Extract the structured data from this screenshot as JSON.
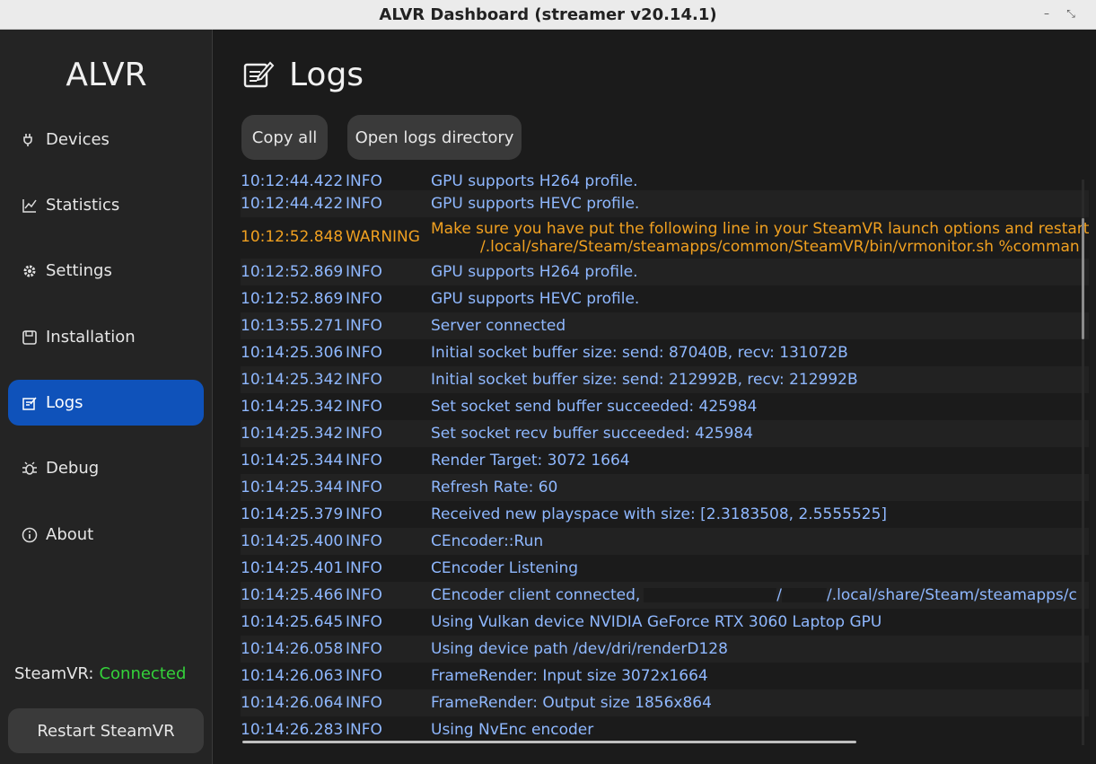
{
  "window": {
    "title": "ALVR Dashboard (streamer v20.14.1)"
  },
  "sidebar": {
    "brand": "ALVR",
    "items": [
      {
        "label": "Devices",
        "icon": "plug-icon"
      },
      {
        "label": "Statistics",
        "icon": "chart-icon"
      },
      {
        "label": "Settings",
        "icon": "gear-icon"
      },
      {
        "label": "Installation",
        "icon": "disk-icon"
      },
      {
        "label": "Logs",
        "icon": "notepad-icon",
        "active": true
      },
      {
        "label": "Debug",
        "icon": "bug-icon"
      },
      {
        "label": "About",
        "icon": "info-icon"
      }
    ],
    "steamvr_label": "SteamVR:",
    "steamvr_state": "Connected",
    "restart_label": "Restart SteamVR"
  },
  "main": {
    "title": "Logs",
    "copy_all_label": "Copy all",
    "open_dir_label": "Open logs directory"
  },
  "logs": [
    {
      "time": "10:12:44.422",
      "level": "INFO",
      "msg": "GPU supports H264 profile."
    },
    {
      "time": "10:12:44.422",
      "level": "INFO",
      "msg": "GPU supports HEVC profile."
    },
    {
      "time": "10:12:52.848",
      "level": "WARNING",
      "msg": "Make sure you have put the following line in your SteamVR launch options and restart it:",
      "msg2": "/.local/share/Steam/steamapps/common/SteamVR/bin/vrmonitor.sh %comman"
    },
    {
      "time": "10:12:52.869",
      "level": "INFO",
      "msg": "GPU supports H264 profile."
    },
    {
      "time": "10:12:52.869",
      "level": "INFO",
      "msg": "GPU supports HEVC profile."
    },
    {
      "time": "10:13:55.271",
      "level": "INFO",
      "msg": "Server connected"
    },
    {
      "time": "10:14:25.306",
      "level": "INFO",
      "msg": "Initial socket buffer size: send: 87040B, recv: 131072B"
    },
    {
      "time": "10:14:25.342",
      "level": "INFO",
      "msg": "Initial socket buffer size: send: 212992B, recv: 212992B"
    },
    {
      "time": "10:14:25.342",
      "level": "INFO",
      "msg": "Set socket send buffer succeeded: 425984"
    },
    {
      "time": "10:14:25.342",
      "level": "INFO",
      "msg": "Set socket recv buffer succeeded: 425984"
    },
    {
      "time": "10:14:25.344",
      "level": "INFO",
      "msg": "Render Target: 3072 1664"
    },
    {
      "time": "10:14:25.344",
      "level": "INFO",
      "msg": "Refresh Rate: 60"
    },
    {
      "time": "10:14:25.379",
      "level": "INFO",
      "msg": "Received new playspace with size: [2.3183508, 2.5555525]"
    },
    {
      "time": "10:14:25.400",
      "level": "INFO",
      "msg": "CEncoder::Run"
    },
    {
      "time": "10:14:25.401",
      "level": "INFO",
      "msg": "CEncoder Listening"
    },
    {
      "time": "10:14:25.466",
      "level": "INFO",
      "msg": "CEncoder client connected,",
      "msg2": "/.local/share/Steam/steamapps/c"
    },
    {
      "time": "10:14:25.645",
      "level": "INFO",
      "msg": "Using Vulkan device NVIDIA GeForce RTX 3060 Laptop GPU"
    },
    {
      "time": "10:14:26.058",
      "level": "INFO",
      "msg": "Using device path /dev/dri/renderD128"
    },
    {
      "time": "10:14:26.063",
      "level": "INFO",
      "msg": "FrameRender: Input size 3072x1664"
    },
    {
      "time": "10:14:26.064",
      "level": "INFO",
      "msg": "FrameRender: Output size 1856x864"
    },
    {
      "time": "10:14:26.283",
      "level": "INFO",
      "msg": "Using NvEnc encoder"
    }
  ]
}
